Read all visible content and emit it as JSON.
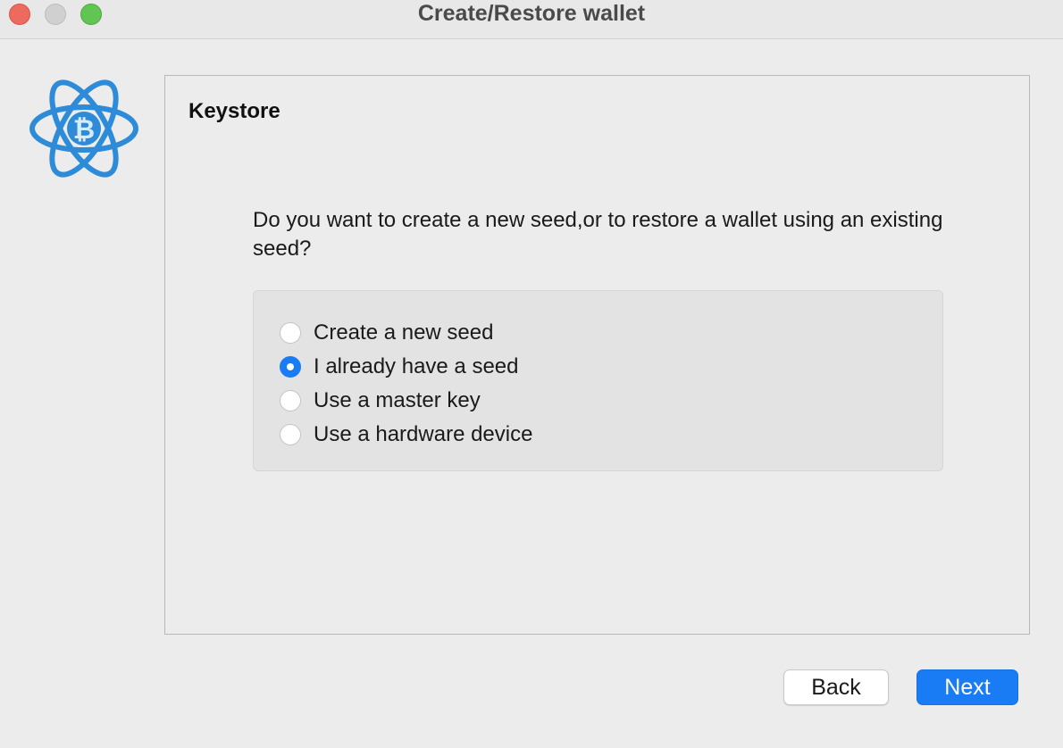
{
  "window": {
    "title": "Create/Restore wallet"
  },
  "panel": {
    "title": "Keystore",
    "question": "Do you want to create a new seed,or to restore a wallet using an existing seed?"
  },
  "options": [
    {
      "label": "Create a new seed",
      "checked": false
    },
    {
      "label": "I already have a seed",
      "checked": true
    },
    {
      "label": "Use a master key",
      "checked": false
    },
    {
      "label": "Use a hardware device",
      "checked": false
    }
  ],
  "buttons": {
    "back": "Back",
    "next": "Next"
  },
  "colors": {
    "accent": "#1a7cf5",
    "logo": "#2d8bd8"
  },
  "icons": {
    "logo": "electrum-bitcoin-logo"
  }
}
